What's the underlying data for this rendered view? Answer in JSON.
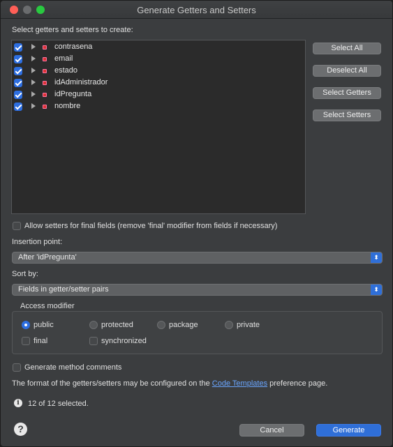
{
  "window": {
    "title": "Generate Getters and Setters"
  },
  "header": {
    "instruction": "Select getters and setters to create:"
  },
  "fields": [
    {
      "name": "contrasena",
      "checked": true
    },
    {
      "name": "email",
      "checked": true
    },
    {
      "name": "estado",
      "checked": true
    },
    {
      "name": "idAdministrador",
      "checked": true
    },
    {
      "name": "idPregunta",
      "checked": true
    },
    {
      "name": "nombre",
      "checked": true
    }
  ],
  "side_buttons": {
    "select_all": "Select All",
    "deselect_all": "Deselect All",
    "select_getters": "Select Getters",
    "select_setters": "Select Setters"
  },
  "allow_setters": {
    "label": "Allow setters for final fields (remove 'final' modifier from fields if necessary)",
    "checked": false
  },
  "insertion_point": {
    "label": "Insertion point:",
    "value": "After 'idPregunta'"
  },
  "sort_by": {
    "label": "Sort by:",
    "value": "Fields in getter/setter pairs"
  },
  "access_modifier": {
    "title": "Access modifier",
    "options": [
      "public",
      "protected",
      "package",
      "private"
    ],
    "selected": "public",
    "final_label": "final",
    "synchronized_label": "synchronized"
  },
  "generate_comments": {
    "label": "Generate method comments",
    "checked": false
  },
  "format_note": {
    "prefix": "The format of the getters/setters may be configured on the",
    "link": "Code Templates",
    "suffix": "preference page."
  },
  "status": {
    "text": "12 of 12 selected."
  },
  "footer": {
    "cancel": "Cancel",
    "generate": "Generate"
  },
  "colors": {
    "accent": "#2f6fd8",
    "link": "#6aa6ff",
    "field_icon": "#dd3333"
  },
  "icons": {
    "info": "i",
    "help": "?"
  }
}
